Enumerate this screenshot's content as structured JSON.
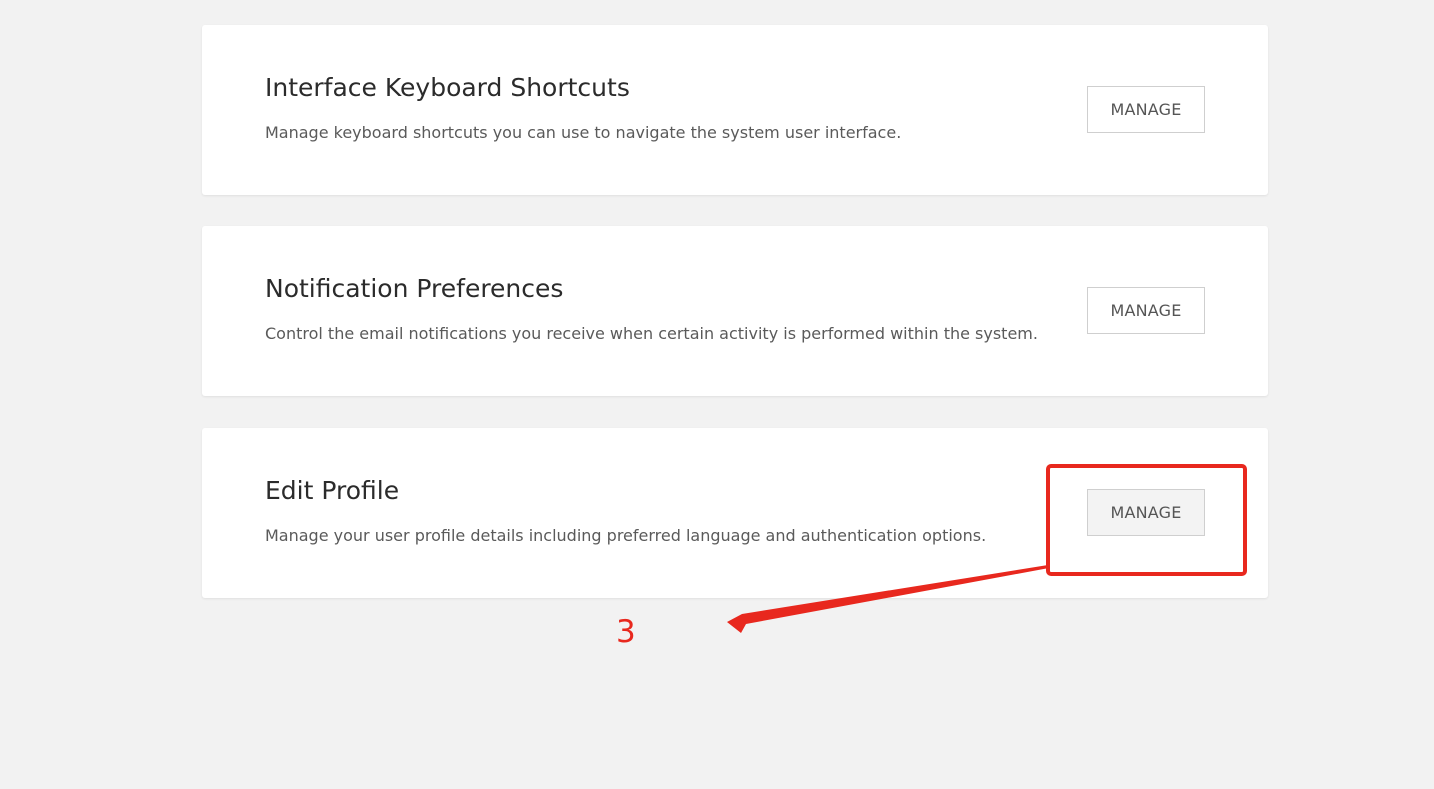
{
  "cards": [
    {
      "title": "Interface Keyboard Shortcuts",
      "description": "Manage keyboard shortcuts you can use to navigate the system user interface.",
      "button_label": "MANAGE"
    },
    {
      "title": "Notification Preferences",
      "description": "Control the email notifications you receive when certain activity is performed within the system.",
      "button_label": "MANAGE"
    },
    {
      "title": "Edit Profile",
      "description": "Manage your user profile details including preferred language and authentication options.",
      "button_label": "MANAGE"
    }
  ],
  "annotation": {
    "step_label": "3",
    "color": "#e8281e",
    "highlighted_button": "edit-profile-manage-button"
  },
  "colors": {
    "page_background": "#f2f2f2",
    "card_background": "#ffffff",
    "title_text": "#2b2b2b",
    "description_text": "#5a5a5a",
    "button_border": "#cfcfcf"
  }
}
